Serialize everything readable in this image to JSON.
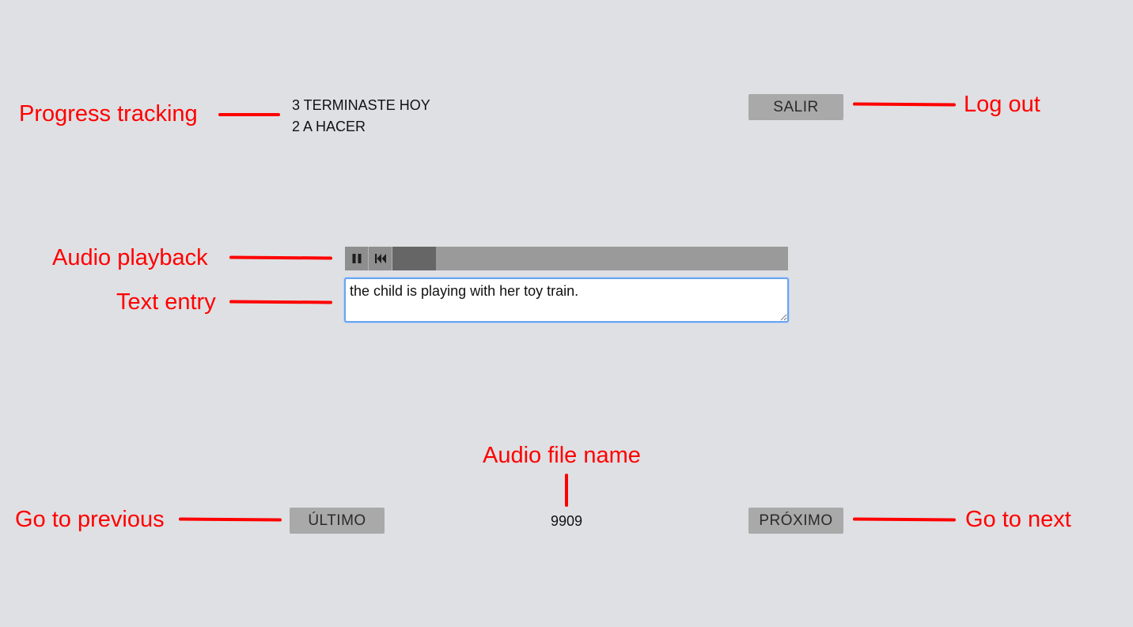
{
  "progress": {
    "done_today": "3 TERMINASTE HOY",
    "to_do": "2 A HACER"
  },
  "header": {
    "logout_label": "SALIR"
  },
  "player": {
    "pause_icon": "pause-icon",
    "rewind_icon": "skip-back-icon",
    "played_fraction": 0.11
  },
  "transcription": {
    "value": "the child is playing with her toy train."
  },
  "footer": {
    "previous_label": "ÚLTIMO",
    "file_name": "9909",
    "next_label": "PRÓXIMO"
  },
  "annotations": {
    "progress_tracking": "Progress tracking",
    "log_out": "Log out",
    "audio_playback": "Audio playback",
    "text_entry": "Text entry",
    "audio_file_name": "Audio file name",
    "go_to_previous": "Go to previous",
    "go_to_next": "Go to next"
  },
  "colors": {
    "annotation": "#ff0000",
    "background": "#dfe0e3",
    "button": "#a9a9a9",
    "textarea_focus": "#6aa4ef"
  }
}
